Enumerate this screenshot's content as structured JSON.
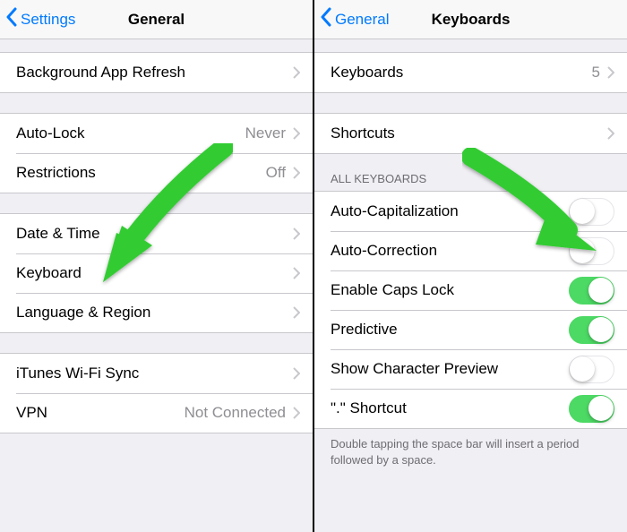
{
  "colors": {
    "blue": "#007aff",
    "green": "#4cd964",
    "arrow": "#33cc33"
  },
  "left": {
    "nav_back": "Settings",
    "nav_title": "General",
    "rows": {
      "bg_refresh": "Background App Refresh",
      "auto_lock": "Auto-Lock",
      "auto_lock_value": "Never",
      "restrictions": "Restrictions",
      "restrictions_value": "Off",
      "date_time": "Date & Time",
      "keyboard": "Keyboard",
      "language_region": "Language & Region",
      "itunes_wifi": "iTunes Wi-Fi Sync",
      "vpn": "VPN",
      "vpn_value": "Not Connected"
    }
  },
  "right": {
    "nav_back": "General",
    "nav_title": "Keyboards",
    "rows": {
      "keyboards": "Keyboards",
      "keyboards_value": "5",
      "shortcuts": "Shortcuts",
      "section_header": "ALL KEYBOARDS",
      "auto_cap": "Auto-Capitalization",
      "auto_corr": "Auto-Correction",
      "caps_lock": "Enable Caps Lock",
      "predictive": "Predictive",
      "show_preview": "Show Character Preview",
      "period_shortcut": "\".\" Shortcut",
      "footer": "Double tapping the space bar will insert a period followed by a space."
    },
    "switches": {
      "auto_cap": false,
      "auto_corr": false,
      "caps_lock": true,
      "predictive": true,
      "show_preview": false,
      "period_shortcut": true
    }
  }
}
